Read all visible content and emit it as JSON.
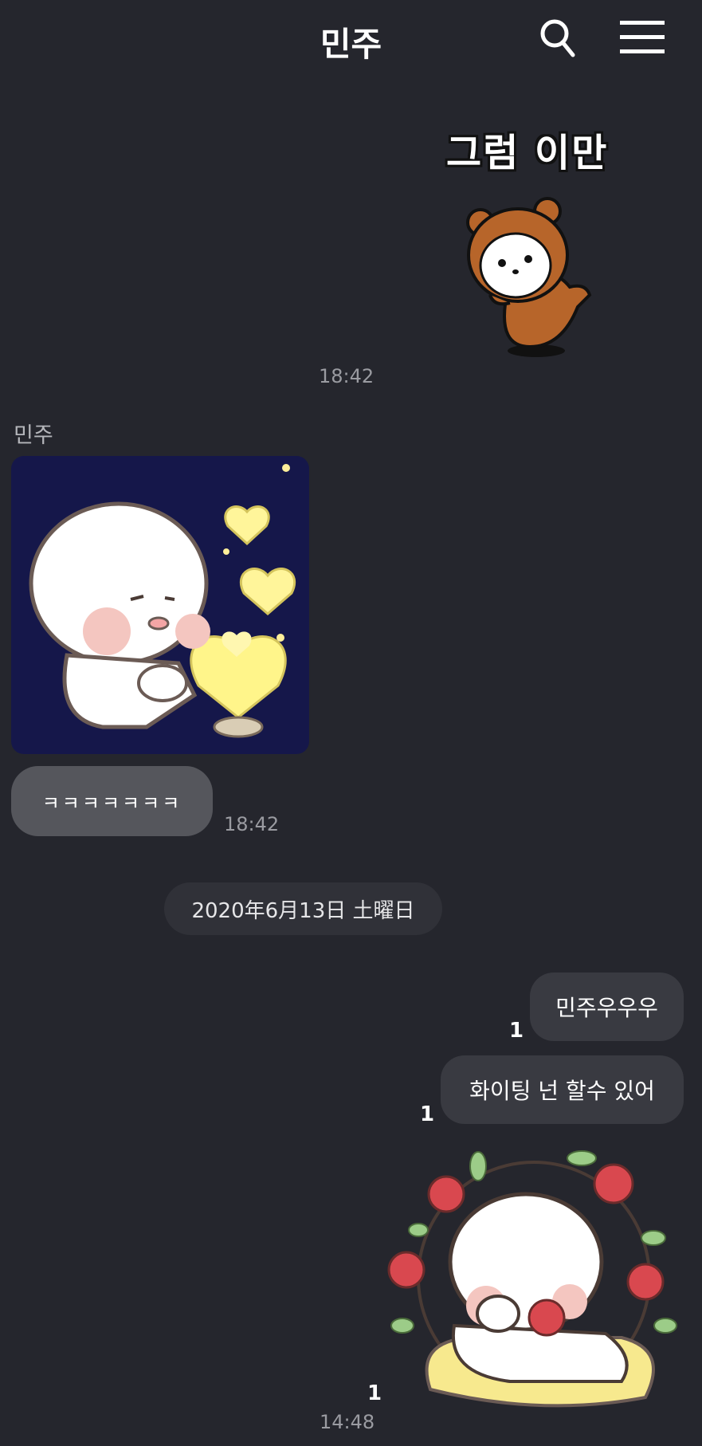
{
  "header": {
    "title": "민주",
    "search_icon": "search-icon",
    "menu_icon": "hamburger-menu-icon"
  },
  "messages": [
    {
      "type": "sticker",
      "side": "me",
      "sticker_text": "그럼 이만",
      "time": "18:42"
    },
    {
      "type": "image",
      "side": "other",
      "sender": "민주"
    },
    {
      "type": "text",
      "side": "other",
      "text": "ㅋㅋㅋㅋㅋㅋㅋ",
      "time": "18:42"
    },
    {
      "type": "date",
      "text": "2020年6月13日 土曜日"
    },
    {
      "type": "text",
      "side": "me",
      "text": "민주우우우",
      "unread": "1"
    },
    {
      "type": "text",
      "side": "me",
      "text": "화이팅 넌 할수 있어",
      "unread": "1"
    },
    {
      "type": "sticker",
      "side": "me",
      "unread": "1",
      "time": "14:48"
    }
  ],
  "colors": {
    "background": "#25262d",
    "my_bubble": "#393a41",
    "other_bubble": "#55565c",
    "date_pill": "#303138"
  }
}
